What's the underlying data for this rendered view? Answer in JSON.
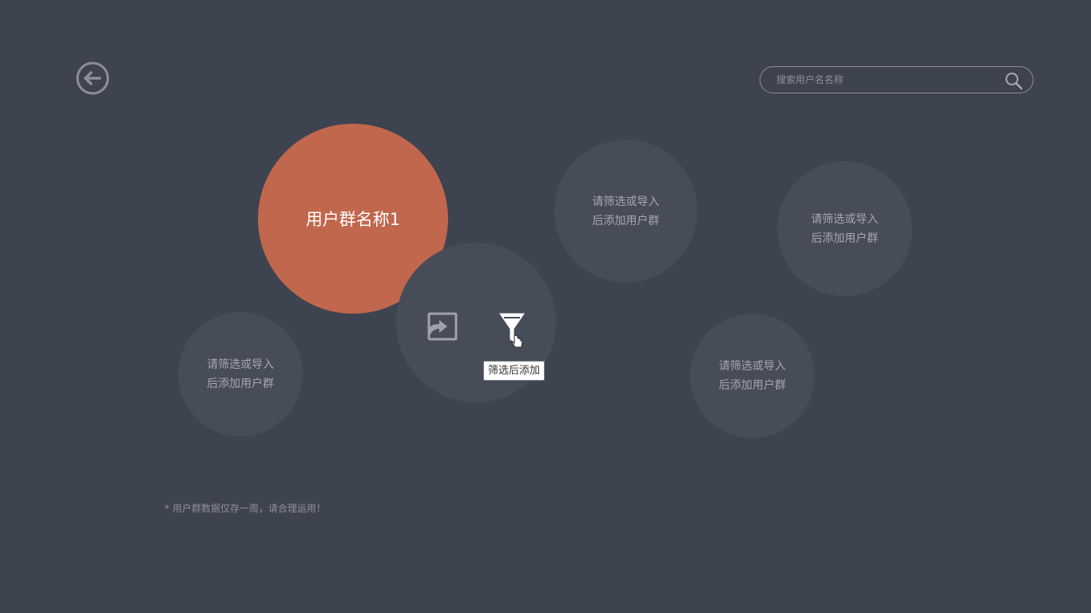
{
  "search": {
    "placeholder": "搜索用户名名称"
  },
  "groups": {
    "active": {
      "label": "用户群名称1"
    },
    "empty_label": "请筛选或导入\n后添加用户群"
  },
  "actions": {
    "import": "import-icon",
    "filter": "filter-icon",
    "filter_tooltip": "筛选后添加"
  },
  "footnote": "* 用户群数据仅存一周，请合理运用！",
  "colors": {
    "background": "#3e4350",
    "accent": "#c0674e",
    "bubble": "#474c59",
    "muted_text": "#a4a8b0"
  }
}
